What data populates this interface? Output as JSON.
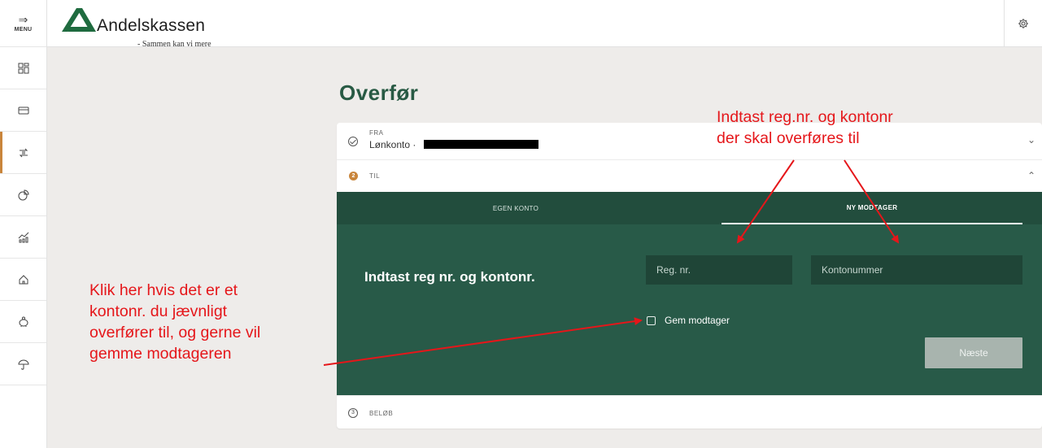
{
  "app": {
    "menu_label": "MENU",
    "brand_name": "Andelskassen",
    "brand_tagline": "- Sammen kan vi mere"
  },
  "nav": [
    {
      "icon": "dashboard-icon"
    },
    {
      "icon": "card-icon"
    },
    {
      "icon": "transfer-icon",
      "active": true
    },
    {
      "icon": "pie-chart-icon"
    },
    {
      "icon": "stats-icon"
    },
    {
      "icon": "home-icon"
    },
    {
      "icon": "piggy-bank-icon"
    },
    {
      "icon": "umbrella-icon"
    }
  ],
  "page": {
    "title": "Overfør"
  },
  "transfer": {
    "from": {
      "label": "FRA",
      "account_name": "Lønkonto",
      "separator": "·"
    },
    "to": {
      "step": "2",
      "label": "TIL",
      "tabs": [
        "EGEN KONTO",
        "NY MODTAGER"
      ],
      "active_tab": "NY MODTAGER",
      "heading": "Indtast reg nr. og kontonr.",
      "reg_placeholder": "Reg. nr.",
      "account_placeholder": "Kontonummer",
      "save_recipient_label": "Gem modtager",
      "save_recipient_checked": false,
      "next_button": "Næste"
    },
    "amount": {
      "step": "3",
      "label": "BELØB"
    }
  },
  "annotations": {
    "right_line1": "Indtast reg.nr. og kontonr",
    "right_line2": "der skal overføres til",
    "left_line1": "Klik her hvis det er et",
    "left_line2": "kontonr. du jævnligt",
    "left_line3": "overfører til, og gerne vil",
    "left_line4": "gemme modtageren"
  },
  "colors": {
    "brand_green": "#285a48",
    "accent_orange": "#c9853b",
    "annotation_red": "#e5161a"
  }
}
